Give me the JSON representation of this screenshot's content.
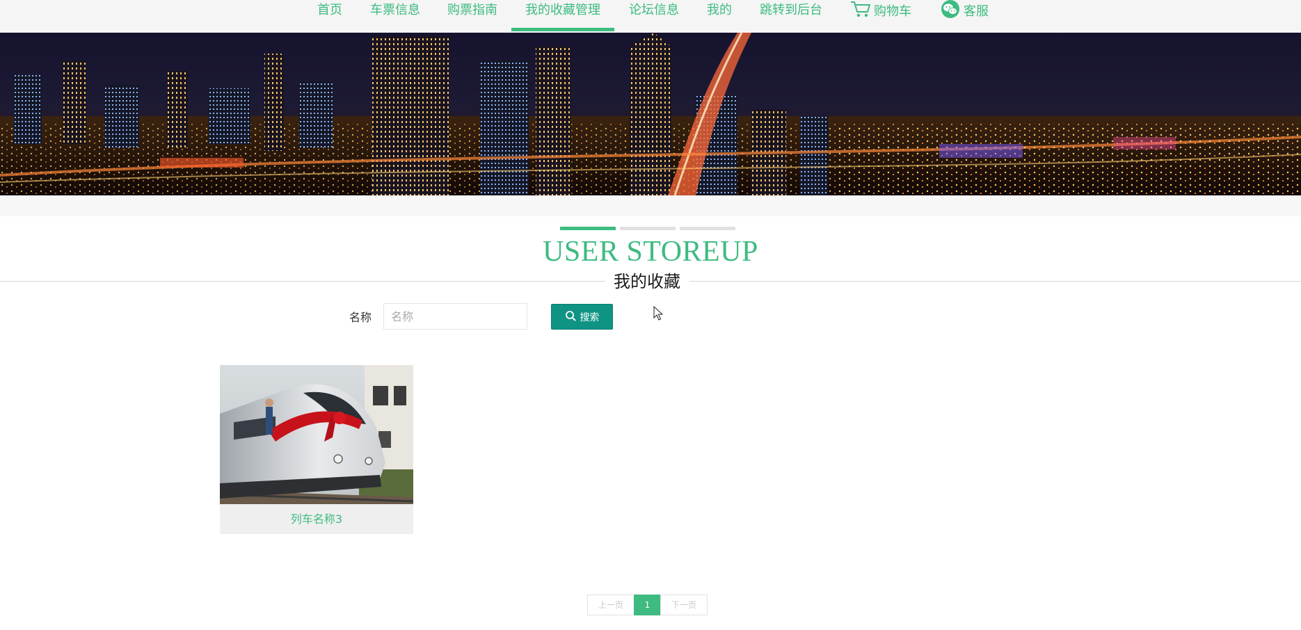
{
  "nav": {
    "items": [
      {
        "label": "首页"
      },
      {
        "label": "车票信息"
      },
      {
        "label": "购票指南"
      },
      {
        "label": "我的收藏管理"
      },
      {
        "label": "论坛信息"
      },
      {
        "label": "我的"
      },
      {
        "label": "跳转到后台"
      },
      {
        "label": "购物车",
        "icon": "cart-icon"
      },
      {
        "label": "客服",
        "icon": "wechat-icon"
      }
    ],
    "active": "我的收藏管理"
  },
  "banner": {
    "image": "city-night-skyline"
  },
  "section": {
    "title_en": "USER STOREUP",
    "title_cn": "我的收藏"
  },
  "search": {
    "label": "名称",
    "placeholder": "名称",
    "value": "",
    "button_label": "搜索",
    "button_icon": "search-icon"
  },
  "items": [
    {
      "name": "列车名称3",
      "image": "train-with-red-ribbon"
    }
  ],
  "pagination": {
    "prev_label": "上一页",
    "current_page": "1",
    "next_label": "下一页"
  },
  "colors": {
    "accent": "#3dbb80",
    "button": "#0f9484",
    "nav_bg": "#f5f5f5"
  }
}
